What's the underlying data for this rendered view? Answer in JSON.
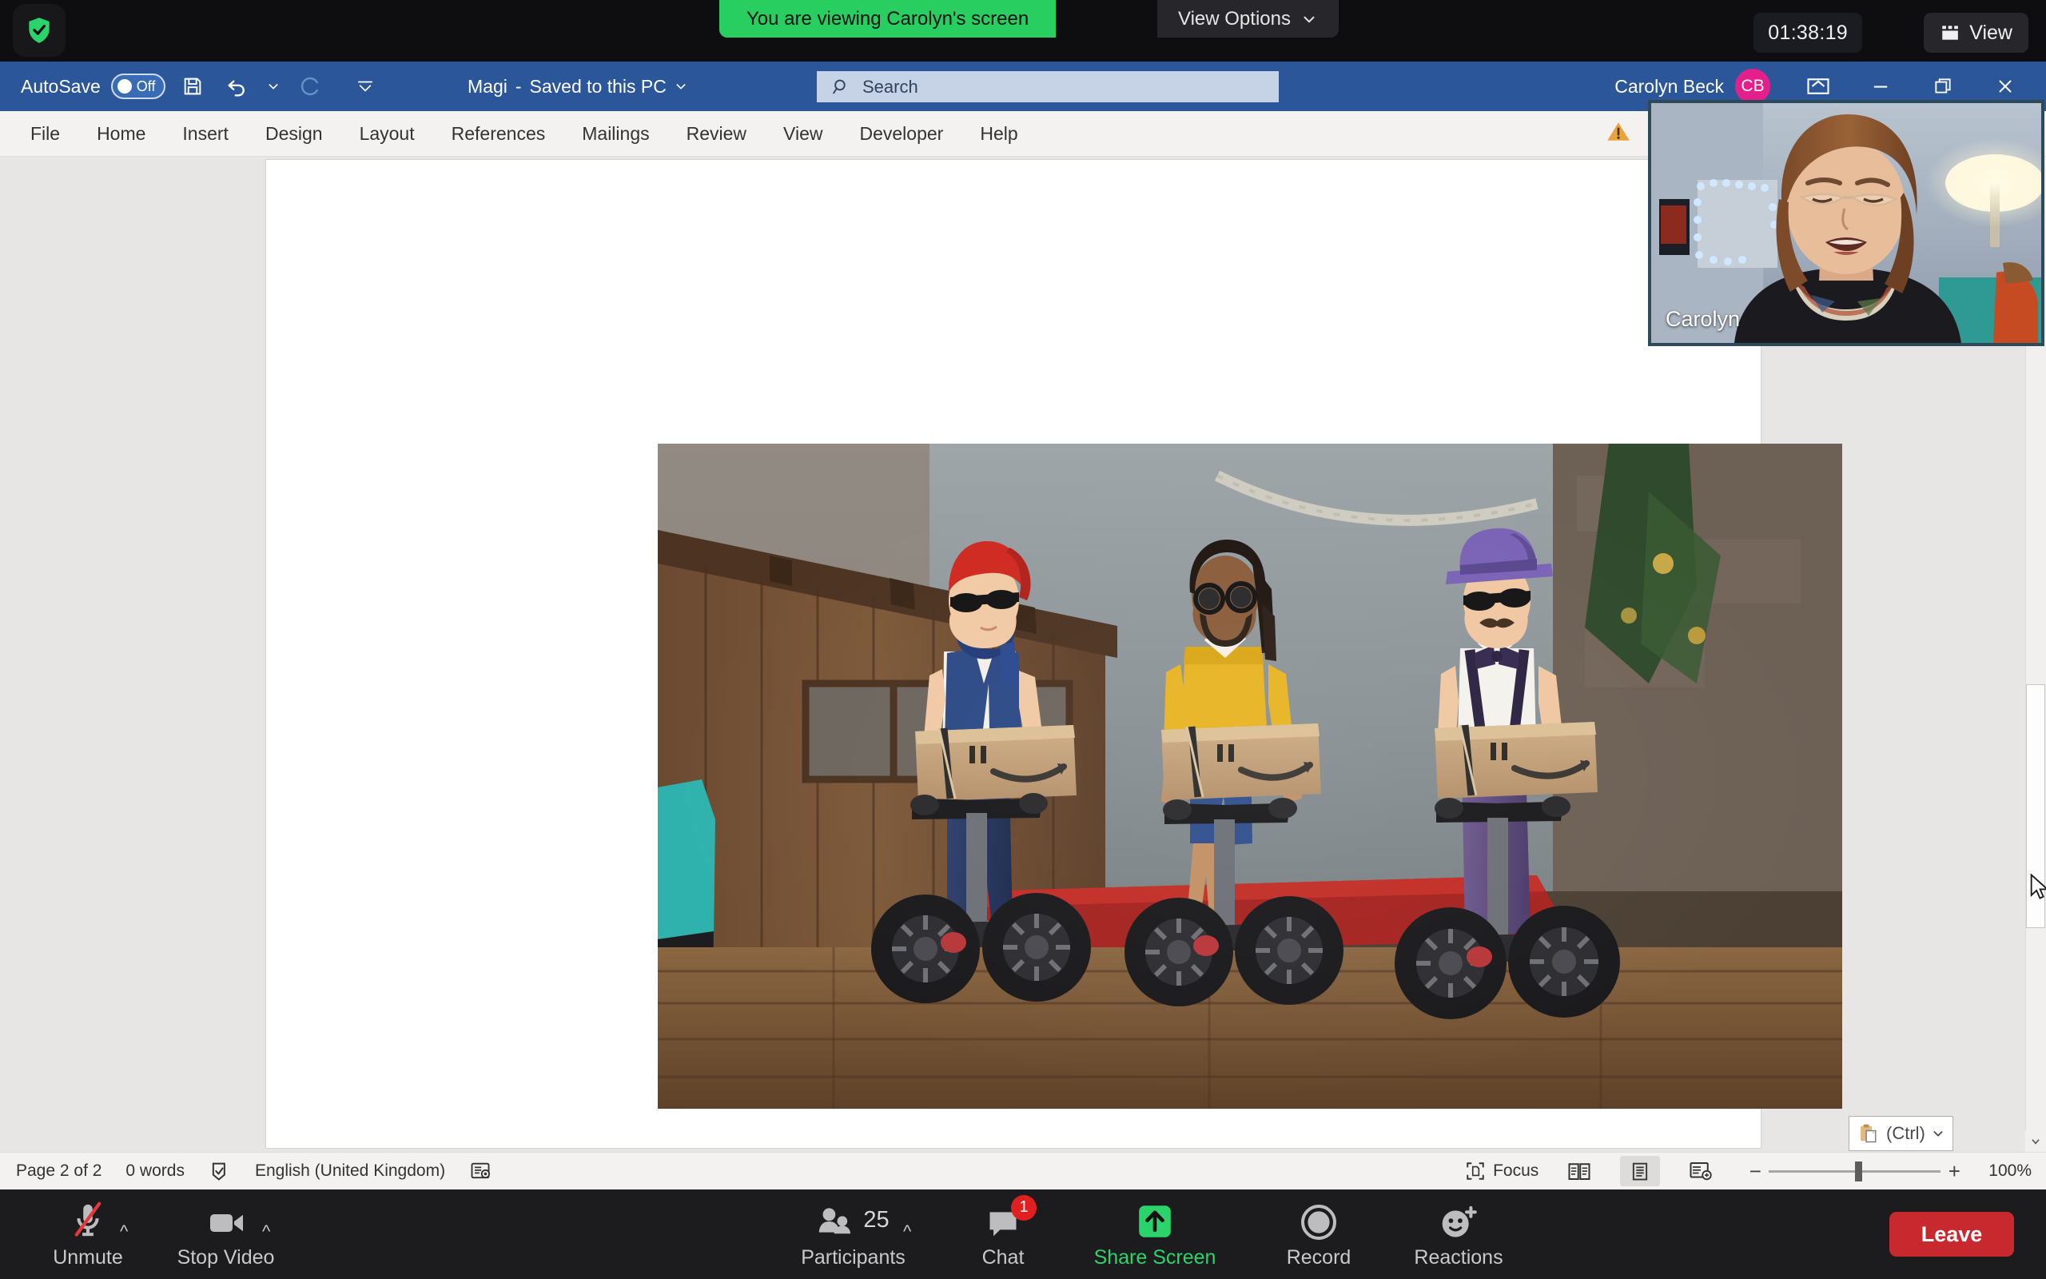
{
  "zoom_top": {
    "security_icon": "shield-check-icon",
    "share_banner": "You are viewing Carolyn's screen",
    "view_options_label": "View Options",
    "view_options_icon": "chevron-down-icon",
    "timer": "01:38:19",
    "view_label": "View",
    "view_icon": "layout-grid-icon",
    "banner_color": "#28ce5f"
  },
  "word": {
    "titlebar": {
      "autosave_label": "AutoSave",
      "autosave_state": "Off",
      "save_icon": "save-icon",
      "undo_icon": "undo-icon",
      "undo_caret_icon": "chevron-down-icon",
      "redo_icon": "redo-icon",
      "customize_icon": "customize-quick-access-icon",
      "doc_name": "Magi",
      "doc_separator": "-",
      "save_state": "Saved to this PC",
      "doc_caret_icon": "chevron-down-icon",
      "user_name": "Carolyn Beck",
      "avatar_initials": "CB",
      "warning_icon": "warning-icon",
      "ribbon_display_icon": "ribbon-display-options-icon",
      "minimize_icon": "minimize-icon",
      "restore_icon": "restore-icon",
      "close_icon": "close-icon",
      "accent_color": "#2b579a"
    },
    "search": {
      "icon": "search-icon",
      "placeholder": "Search",
      "value": ""
    },
    "ribbon_tabs": [
      {
        "label": "File",
        "active": false
      },
      {
        "label": "Home",
        "active": false
      },
      {
        "label": "Insert",
        "active": false
      },
      {
        "label": "Design",
        "active": false
      },
      {
        "label": "Layout",
        "active": false
      },
      {
        "label": "References",
        "active": false
      },
      {
        "label": "Mailings",
        "active": false
      },
      {
        "label": "Review",
        "active": false
      },
      {
        "label": "View",
        "active": false
      },
      {
        "label": "Developer",
        "active": false
      },
      {
        "label": "Help",
        "active": false
      }
    ],
    "document": {
      "image_alt": "Three toy delivery figures on Segways carrying Amazon parcels in front of a wooden stable with Christmas tree and fairy lights",
      "paste_options": {
        "icon": "clipboard-paste-icon",
        "label": "(Ctrl)",
        "caret_icon": "chevron-down-icon"
      },
      "scrollbar": {
        "up_icon": "scroll-up-icon",
        "down_icon": "scroll-down-icon",
        "thumb": "scroll-thumb"
      }
    },
    "status": {
      "page": "Page 2 of 2",
      "words": "0 words",
      "proofing_icon": "proofing-errors-icon",
      "language": "English (United Kingdom)",
      "accessibility_icon": "accessibility-checker-icon",
      "focus_label": "Focus",
      "focus_icon": "focus-mode-icon",
      "read_mode_icon": "read-mode-icon",
      "print_layout_icon": "print-layout-icon",
      "web_layout_icon": "web-layout-icon",
      "zoom_out_icon": "zoom-out-icon",
      "zoom_in_icon": "zoom-in-icon",
      "zoom_level": "100%"
    }
  },
  "video_thumb": {
    "participant_name": "Carolyn"
  },
  "zoom_bottom": {
    "items": [
      {
        "label": "Unmute",
        "icon": "microphone-muted-icon",
        "caret": true,
        "badge": null,
        "highlight": false
      },
      {
        "label": "Stop Video",
        "icon": "video-camera-icon",
        "caret": true,
        "badge": null,
        "highlight": false
      },
      {
        "label": "Participants",
        "icon": "participants-icon",
        "caret": true,
        "badge": null,
        "count": "25",
        "highlight": false
      },
      {
        "label": "Chat",
        "icon": "chat-bubble-icon",
        "caret": false,
        "badge": "1",
        "highlight": false
      },
      {
        "label": "Share Screen",
        "icon": "share-screen-icon",
        "caret": false,
        "badge": null,
        "highlight": true
      },
      {
        "label": "Record",
        "icon": "record-icon",
        "caret": false,
        "badge": null,
        "highlight": false
      },
      {
        "label": "Reactions",
        "icon": "reactions-icon",
        "caret": false,
        "badge": null,
        "highlight": false
      }
    ],
    "leave_label": "Leave",
    "leave_color": "#c8292e",
    "share_color": "#2bd46a"
  }
}
